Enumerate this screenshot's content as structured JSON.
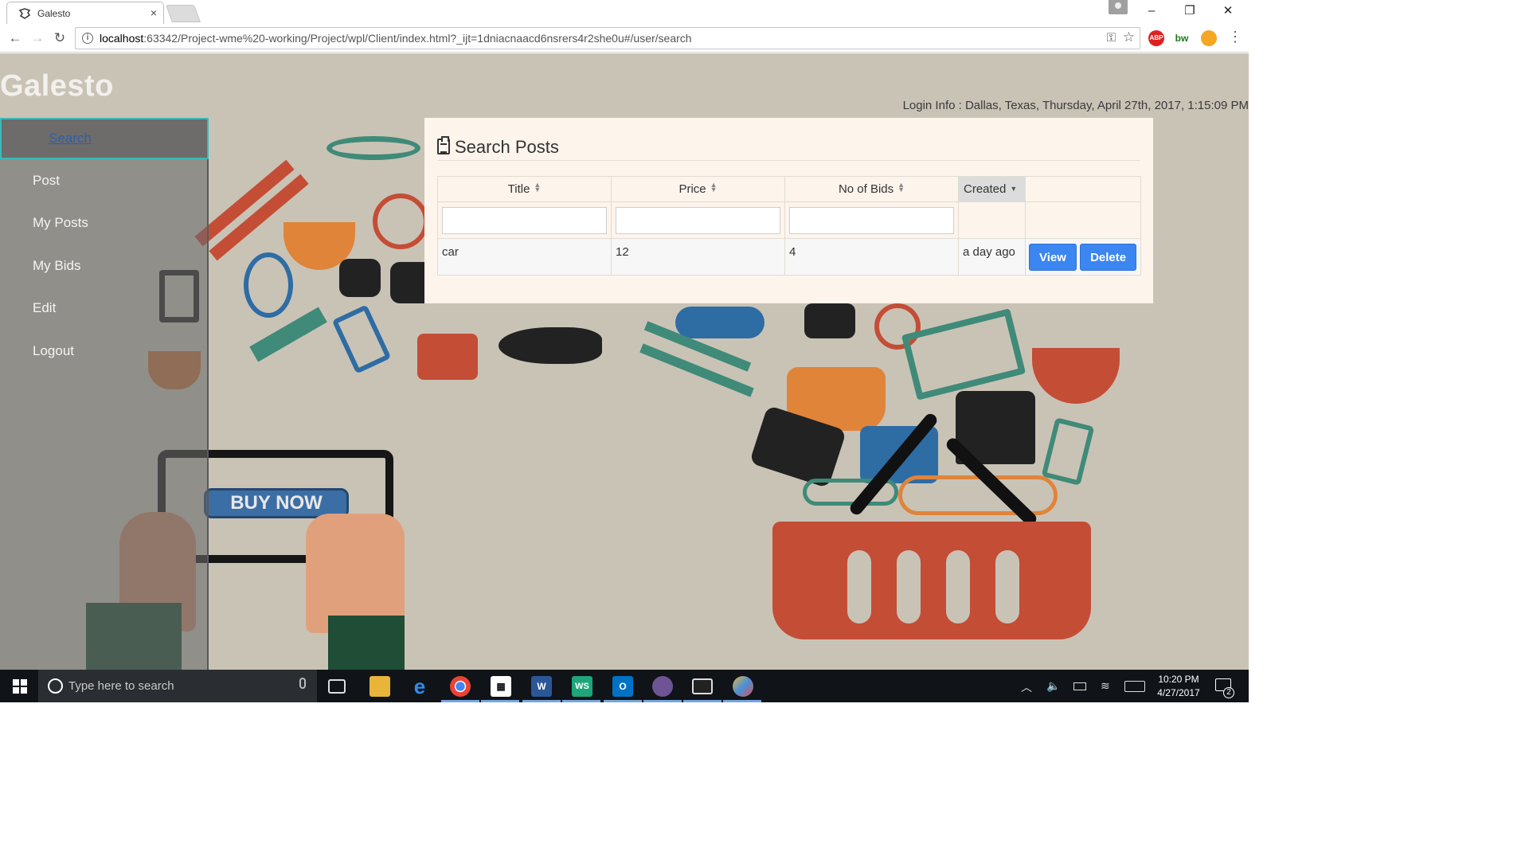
{
  "browser": {
    "tab_title": "Galesto",
    "tab_close": "×",
    "url_host": "localhost",
    "url_path": ":63342/Project-wme%20-working/Project/wpl/Client/index.html?_ijt=1dniacnaacd6nsrers4r2she0u#/user/search",
    "window_minimize": "–",
    "window_restore": "❐",
    "window_close": "✕",
    "extensions": {
      "abp": "ABP",
      "bw": "bw"
    }
  },
  "app": {
    "brand": "Galesto",
    "login_info": "Login Info : Dallas, Texas, Thursday, April 27th, 2017, 1:15:09 PM",
    "sidebar": {
      "items": [
        {
          "label": "Search",
          "active": true
        },
        {
          "label": "Post"
        },
        {
          "label": "My Posts"
        },
        {
          "label": "My Bids"
        },
        {
          "label": "Edit"
        },
        {
          "label": "Logout"
        }
      ]
    },
    "search_card": {
      "title": "Search Posts",
      "columns": [
        "Title",
        "Price",
        "No of Bids",
        "Created"
      ],
      "rows": [
        {
          "title": "car",
          "price": "12",
          "bids": "4",
          "created": "a day ago"
        }
      ],
      "view_label": "View",
      "delete_label": "Delete"
    }
  },
  "taskbar": {
    "search_placeholder": "Type here to search",
    "time": "10:20 PM",
    "date": "4/27/2017",
    "notifications": "2",
    "apps": [
      "file-explorer",
      "edge",
      "chrome",
      "store",
      "word",
      "webstorm",
      "outlook",
      "github",
      "terminal",
      "paint"
    ]
  },
  "colors": {
    "accent_blue": "#3b86f0",
    "active_border": "#3bb9b9",
    "card_bg": "#fdf4ec",
    "taskbar_bg": "#101418"
  }
}
